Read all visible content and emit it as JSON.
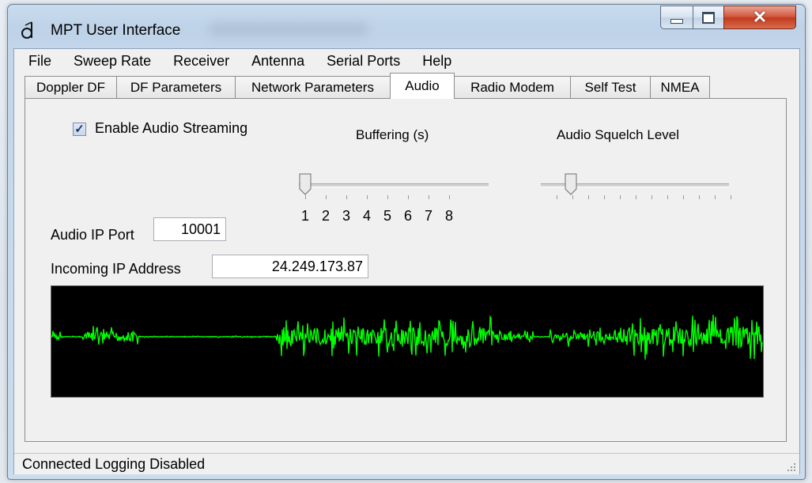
{
  "window": {
    "title": "MPT User Interface"
  },
  "menu": [
    "File",
    "Sweep Rate",
    "Receiver",
    "Antenna",
    "Serial Ports",
    "Help"
  ],
  "tabs": [
    "Doppler DF",
    "DF Parameters",
    "Network Parameters",
    "Audio",
    "Radio Modem",
    "Self Test",
    "NMEA"
  ],
  "active_tab": "Audio",
  "audio": {
    "enable_streaming_label": "Enable Audio Streaming",
    "enable_streaming_checked": true,
    "buffering_label": "Buffering (s)",
    "buffering_ticks": [
      "1",
      "2",
      "3",
      "4",
      "5",
      "6",
      "7",
      "8"
    ],
    "buffering_value": 1,
    "squelch_label": "Audio Squelch Level",
    "squelch_fraction": 0.08,
    "ip_port_label": "Audio IP Port",
    "ip_port_value": "10001",
    "incoming_ip_label": "Incoming IP Address",
    "incoming_ip_value": "24.249.173.87",
    "waveform_color": "#00ff00"
  },
  "status": {
    "text": "Connected  Logging Disabled"
  },
  "colors": {
    "close_button": "#c74a2e",
    "scope_background": "#000000"
  },
  "icons": [
    "app-icon",
    "minimize-icon",
    "maximize-icon",
    "close-icon",
    "checkmark-icon",
    "size-grip-icon"
  ]
}
